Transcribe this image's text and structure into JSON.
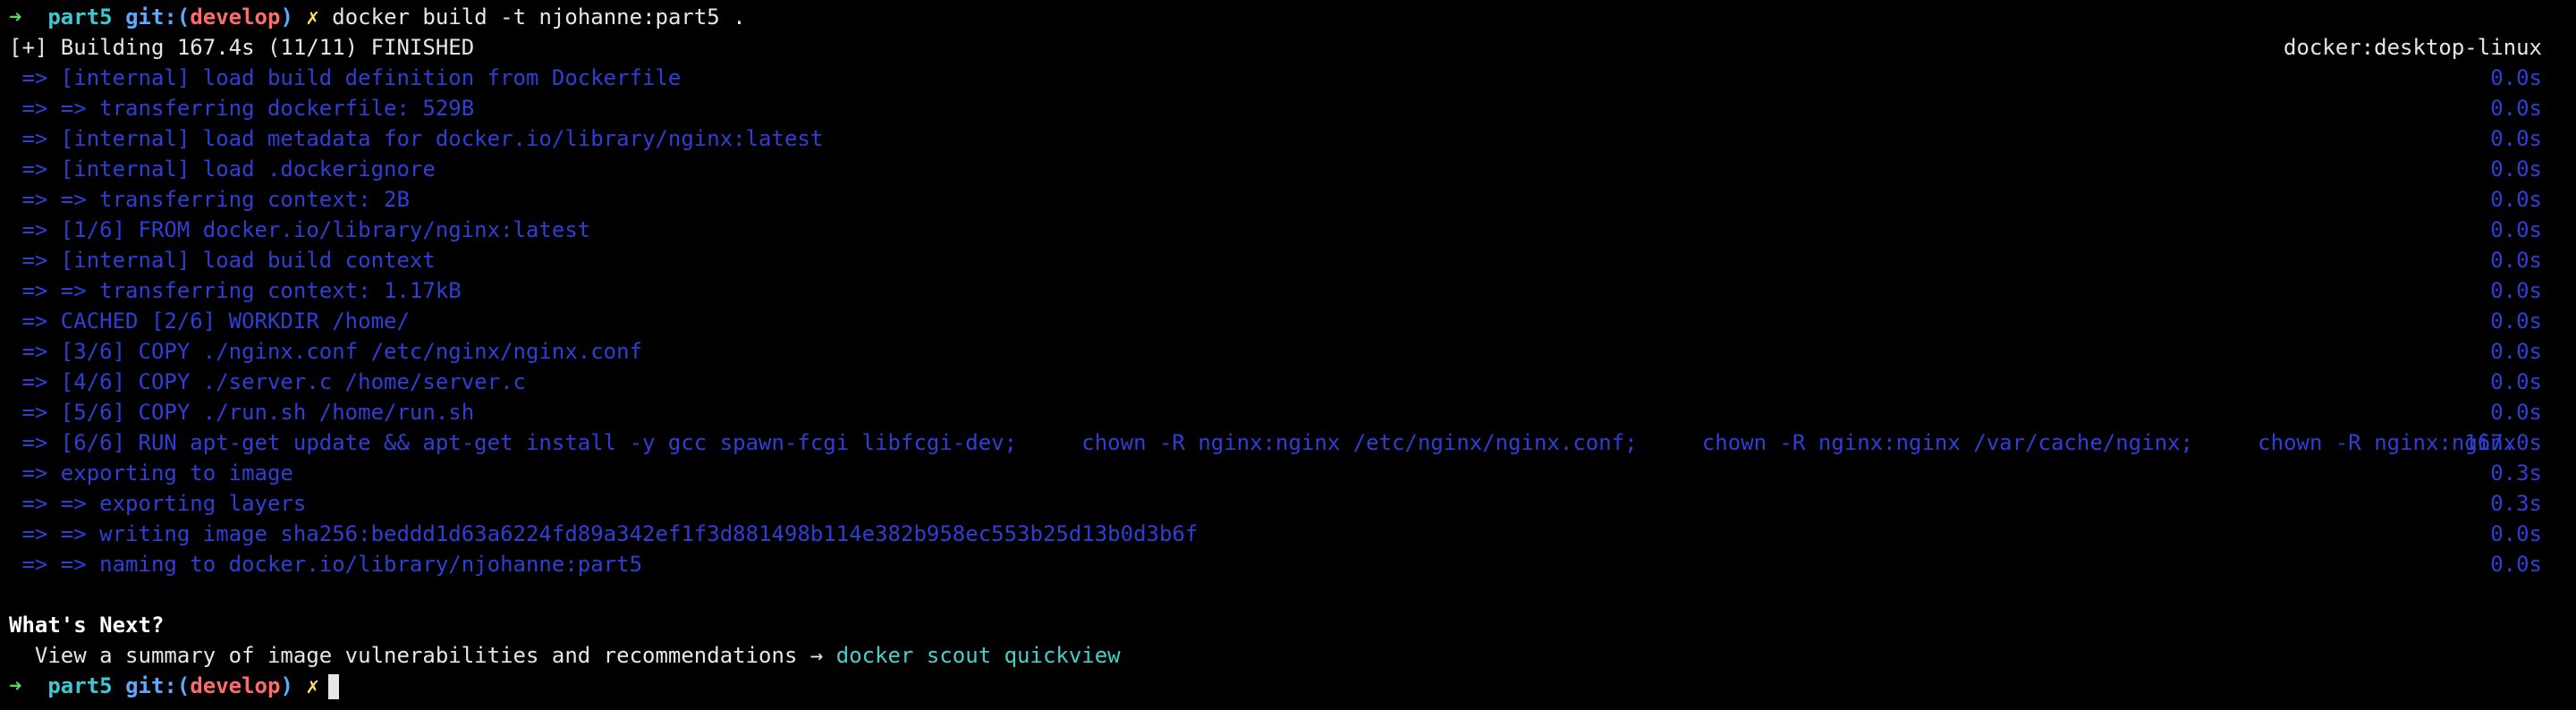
{
  "colors": {
    "background": "#000000",
    "text": "#e6e6e6",
    "prompt_arrow": "#5fd75f",
    "directory": "#3dc8d6",
    "git_label": "#5fa8ff",
    "branch": "#ff6b6b",
    "dirty_mark": "#ffe066",
    "build_step": "#2f3fd6",
    "hint_command": "#44d0c8"
  },
  "prompt": {
    "arrow": "➜",
    "dir": "part5",
    "git_prefix": "git:(",
    "branch": "develop",
    "git_suffix": ")",
    "dirty": "✗"
  },
  "command": "docker build -t njohanne:part5 .",
  "build_header": {
    "status": "[+] Building 167.4s (11/11) FINISHED",
    "context": "docker:desktop-linux"
  },
  "steps": [
    {
      "text": " => [internal] load build definition from Dockerfile",
      "time": "0.0s"
    },
    {
      "text": " => => transferring dockerfile: 529B",
      "time": "0.0s"
    },
    {
      "text": " => [internal] load metadata for docker.io/library/nginx:latest",
      "time": "0.0s"
    },
    {
      "text": " => [internal] load .dockerignore",
      "time": "0.0s"
    },
    {
      "text": " => => transferring context: 2B",
      "time": "0.0s"
    },
    {
      "text": " => [1/6] FROM docker.io/library/nginx:latest",
      "time": "0.0s"
    },
    {
      "text": " => [internal] load build context",
      "time": "0.0s"
    },
    {
      "text": " => => transferring context: 1.17kB",
      "time": "0.0s"
    },
    {
      "text": " => CACHED [2/6] WORKDIR /home/",
      "time": "0.0s"
    },
    {
      "text": " => [3/6] COPY ./nginx.conf /etc/nginx/nginx.conf",
      "time": "0.0s"
    },
    {
      "text": " => [4/6] COPY ./server.c /home/server.c",
      "time": "0.0s"
    },
    {
      "text": " => [5/6] COPY ./run.sh /home/run.sh",
      "time": "0.0s"
    },
    {
      "text": " => [6/6] RUN apt-get update && apt-get install -y gcc spawn-fcgi libfcgi-dev;     chown -R nginx:nginx /etc/nginx/nginx.conf;     chown -R nginx:nginx /var/cache/nginx;     chown -R nginx:nginx",
      "time": "167.0s"
    },
    {
      "text": " => exporting to image",
      "time": "0.3s"
    },
    {
      "text": " => => exporting layers",
      "time": "0.3s"
    },
    {
      "text": " => => writing image sha256:beddd1d63a6224fd89a342ef1f3d881498b114e382b958ec553b25d13b0d3b6f",
      "time": "0.0s"
    },
    {
      "text": " => => naming to docker.io/library/njohanne:part5",
      "time": "0.0s"
    }
  ],
  "whats_next": {
    "heading": "What's Next?",
    "hint_text": "  View a summary of image vulnerabilities and recommendations → ",
    "hint_command": "docker scout quickview"
  }
}
